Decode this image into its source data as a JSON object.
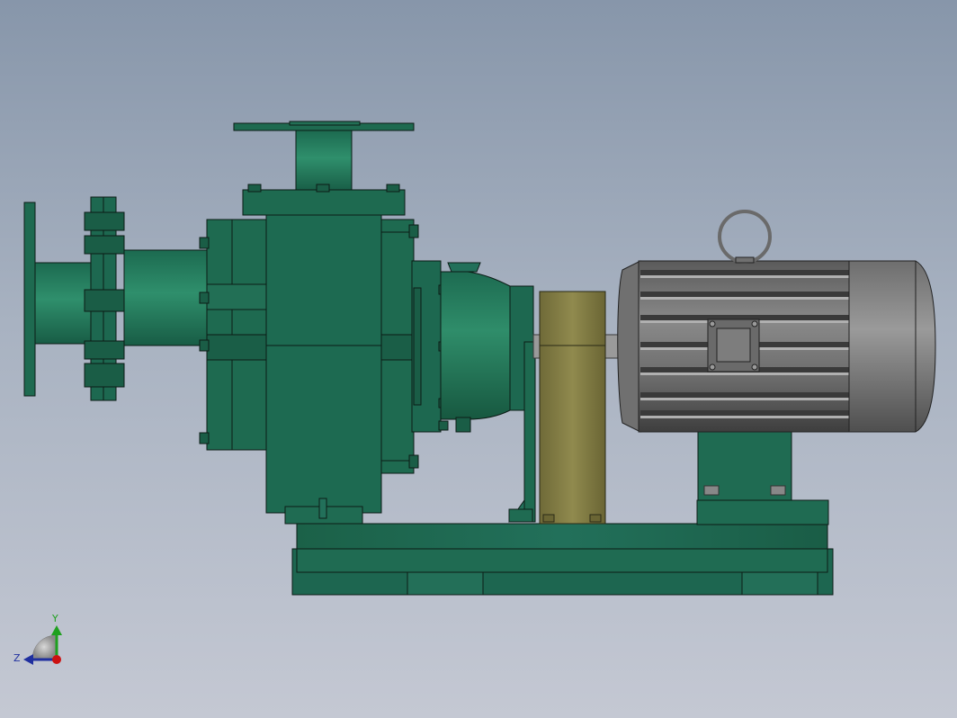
{
  "colors": {
    "pump_green": "#1f6b52",
    "pump_green_dark": "#165440",
    "pump_green_light": "#2e8a6a",
    "coupling_guard": "#8a864a",
    "motor_gray": "#7b7b7b",
    "motor_gray_dark": "#4a4a4a",
    "outline": "#0c1c16"
  },
  "triad": {
    "y_label": "Y",
    "z_label": "Z",
    "y_color": "#1fa01f",
    "z_color": "#1f2f9f",
    "x_color": "#cc1111"
  }
}
